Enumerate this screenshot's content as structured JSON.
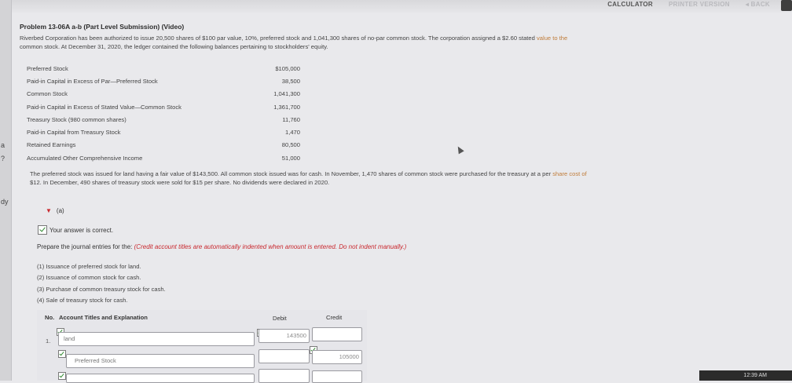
{
  "side_marks": [
    "a",
    "?",
    "dy"
  ],
  "toolbar": {
    "calculator": "CALCULATOR",
    "printer": "PRINTER VERSION",
    "back": "◂ BACK"
  },
  "title": "Problem 13-06A a-b (Part Level Submission) (Video)",
  "intro": {
    "text": "Riverbed Corporation has been authorized to issue 20,500 shares of $100 par value, 10%, preferred stock and 1,041,300 shares of no-par common stock. The corporation assigned a $2.60 stated",
    "faded": "value to the",
    "line2": "common stock. At December 31, 2020, the ledger contained the following balances pertaining to stockholders' equity."
  },
  "balances": [
    {
      "label": "Preferred Stock",
      "amount": "$105,000"
    },
    {
      "label": "Paid-in Capital in Excess of Par—Preferred Stock",
      "amount": "38,500"
    },
    {
      "label": "Common Stock",
      "amount": "1,041,300"
    },
    {
      "label": "Paid-in Capital in Excess of Stated Value—Common Stock",
      "amount": "1,361,700"
    },
    {
      "label": "Treasury Stock (980 common shares)",
      "amount": "11,760"
    },
    {
      "label": "Paid-in Capital from Treasury Stock",
      "amount": "1,470"
    },
    {
      "label": "Retained Earnings",
      "amount": "80,500"
    },
    {
      "label": "Accumulated Other Comprehensive Income",
      "amount": "51,000"
    }
  ],
  "para2": {
    "text": "The preferred stock was issued for land having a fair value of $143,500. All common stock issued was for cash. In November, 1,470 shares of common stock were purchased for the treasury at a per",
    "faded": "share cost of",
    "line2": "$12. In December, 490 shares of treasury stock were sold for $15 per share. No dividends were declared in 2020."
  },
  "part": {
    "label": "(a)"
  },
  "correct_msg": "Your answer is correct.",
  "instruction": {
    "main": "Prepare the journal entries for the:",
    "hint": "(Credit account titles are automatically indented when amount is entered. Do not indent manually.)"
  },
  "steps": [
    "(1)  Issuance of preferred stock for land.",
    "(2)  Issuance of common stock for cash.",
    "(3)  Purchase of common treasury stock for cash.",
    "(4)  Sale of treasury stock for cash."
  ],
  "table": {
    "headers": {
      "no": "No.",
      "account": "Account Titles and Explanation",
      "debit": "Debit",
      "credit": "Credit"
    },
    "rows": [
      {
        "no": "1.",
        "account": "land",
        "debit": "143500",
        "credit": ""
      },
      {
        "no": "",
        "account": "Preferred Stock",
        "debit": "",
        "credit": "105000"
      }
    ]
  },
  "clock": "12:39 AM"
}
